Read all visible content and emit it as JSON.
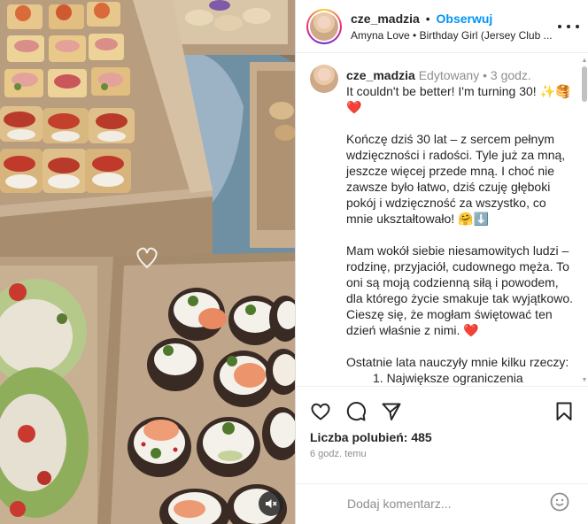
{
  "header": {
    "username": "cze_madzia",
    "separator": "•",
    "follow_label": "Obserwuj",
    "audio_line": "Amyna Love • Birthday Girl (Jersey Club ...",
    "more_icon": "more-horizontal-icon"
  },
  "caption": {
    "username": "cze_madzia",
    "edited_label": "Edytowany",
    "time_ago": "3 godz.",
    "title": "It couldn't be better! I'm turning 30! ✨🥞❤️",
    "paragraphs": [
      "Kończę dziś 30 lat – z sercem pełnym wdzięczności i radości. Tyle już za mną, jeszcze więcej przede mną. I choć nie zawsze było łatwo, dziś czuję głęboki pokój i wdzięczność za wszystko, co mnie ukształtowało! 🤗⬇️",
      "Mam wokół siebie niesamowitych ludzi – rodzinę, przyjaciół, cudownego męża. To oni są moją codzienną siłą i powodem, dla którego życie smakuje tak wyjątkowo. Cieszę się, że mogłam świętować ten dzień właśnie z nimi. ❤️",
      "Ostatnie lata nauczyły mnie kilku rzeczy:"
    ],
    "list_item_1": "1.      Największe ograniczenia"
  },
  "actions": {
    "like_icon": "heart-icon",
    "comment_icon": "comment-icon",
    "share_icon": "paper-plane-icon",
    "save_icon": "bookmark-icon",
    "likes_label": "Liczba polubień: 485",
    "time_label": "6 godz. temu"
  },
  "comment": {
    "placeholder": "Dodaj komentarz...",
    "emoji_icon": "smiley-icon"
  },
  "media": {
    "mute_icon": "speaker-muted-icon"
  },
  "colors": {
    "accent": "#0095f6",
    "text": "#262626",
    "muted": "#8e8e8e",
    "heart_red": "#ed4956"
  }
}
